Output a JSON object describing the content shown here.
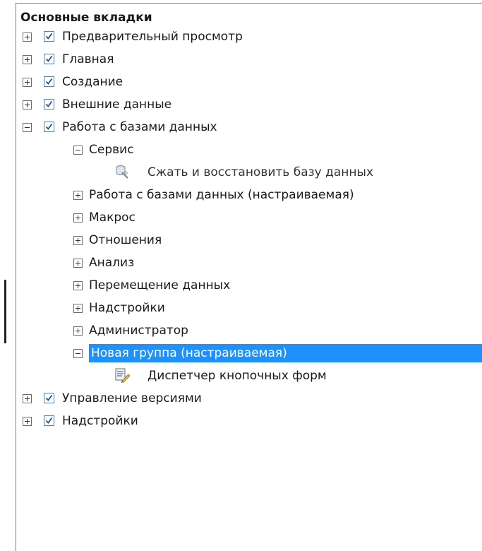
{
  "header": {
    "title": "Основные вкладки"
  },
  "tree": {
    "preview": "Предварительный просмотр",
    "home": "Главная",
    "create": "Создание",
    "external": "Внешние данные",
    "dbtools": "Работа с базами данных",
    "dbtools_groups": {
      "service": "Сервис",
      "compact_cmd": "Сжать и восстановить базу данных",
      "dbtools_custom": "Работа с базами данных (настраиваемая)",
      "macro": "Макрос",
      "relations": "Отношения",
      "analysis": "Анализ",
      "move_data": "Перемещение данных",
      "addins": "Надстройки",
      "admin": "Администратор",
      "new_group": "Новая группа (настраиваемая)",
      "switchboard_cmd": "Диспетчер кнопочных форм"
    },
    "versions": "Управление версиями",
    "addins_tab": "Надстройки"
  },
  "colors": {
    "selection": "#1e90ff",
    "checkmark": "#1f4f8f"
  },
  "icons": {
    "compact": "compact-repair-icon",
    "switchboard": "switchboard-manager-icon"
  }
}
